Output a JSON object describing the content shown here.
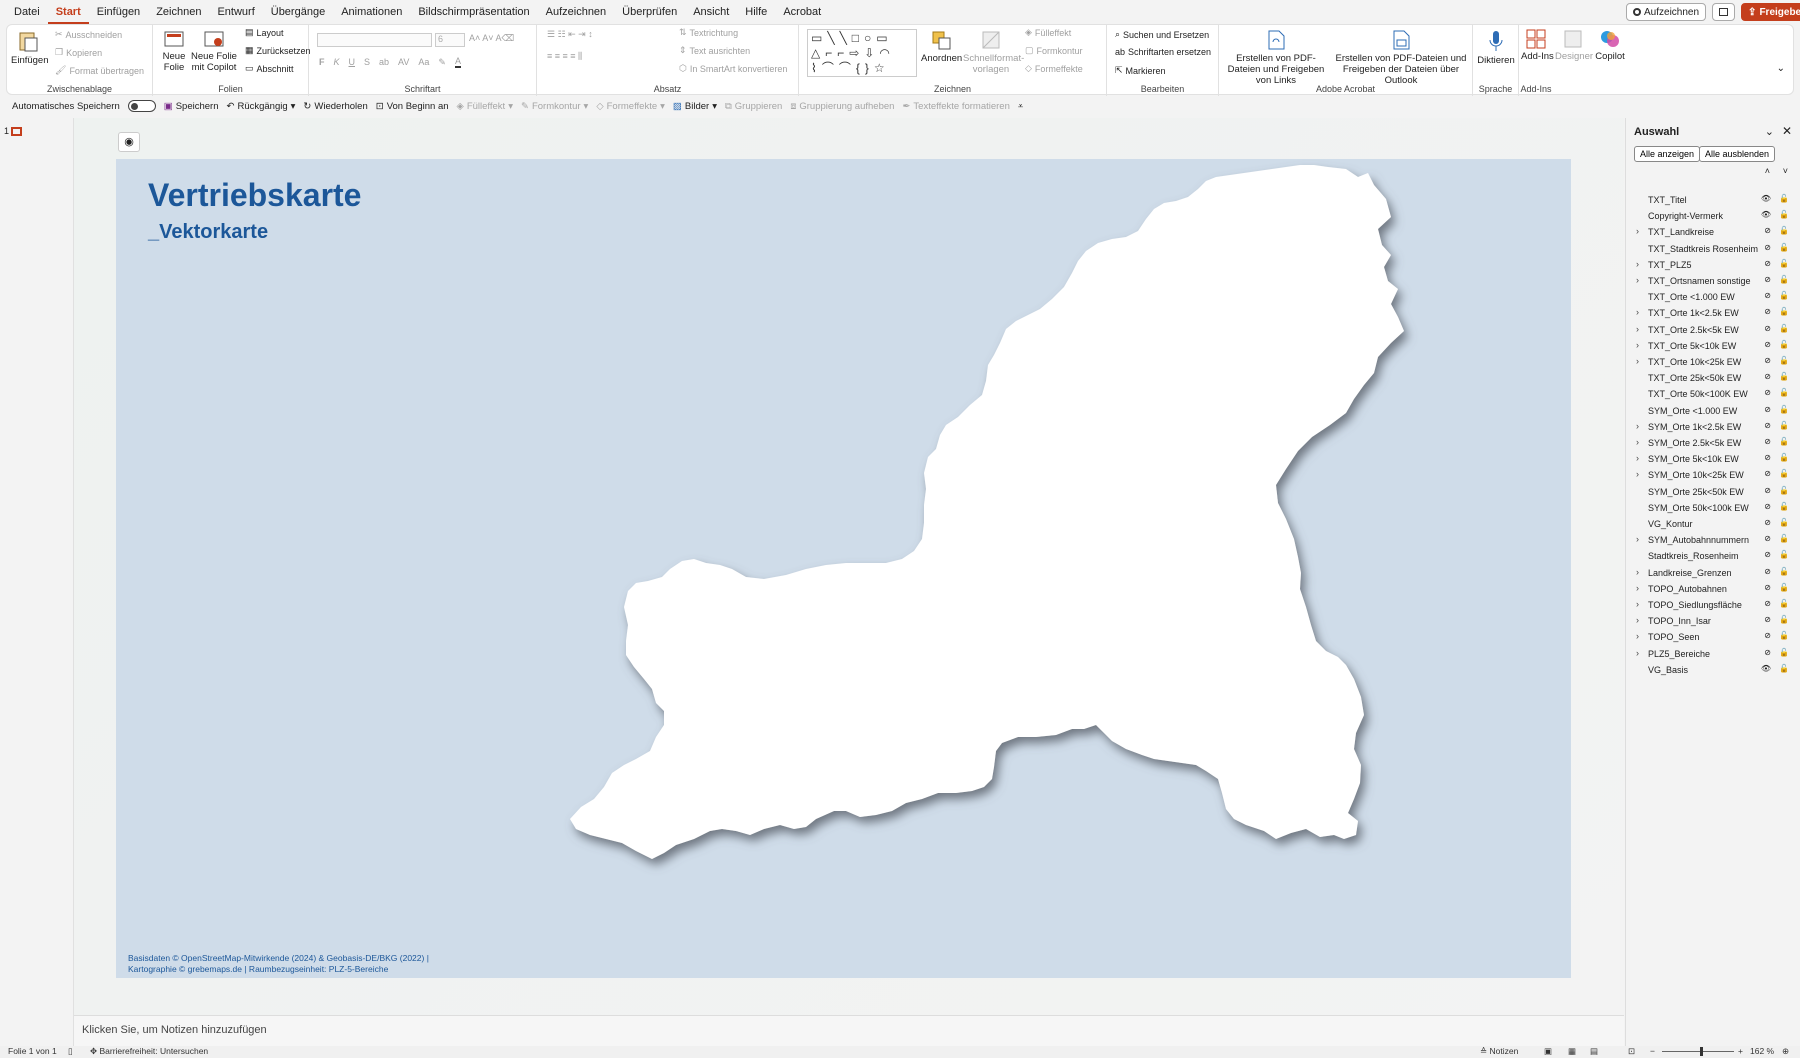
{
  "menubar": {
    "tabs": [
      "Datei",
      "Start",
      "Einfügen",
      "Zeichnen",
      "Entwurf",
      "Übergänge",
      "Animationen",
      "Bildschirmpräsentation",
      "Aufzeichnen",
      "Überprüfen",
      "Ansicht",
      "Hilfe",
      "Acrobat"
    ],
    "active_tab": "Start",
    "record_label": "Aufzeichnen",
    "share_label": "Freigeben"
  },
  "ribbon": {
    "clipboard": {
      "label": "Zwischenablage",
      "paste": "Einfügen",
      "cut": "Ausschneiden",
      "copy": "Kopieren",
      "format_painter": "Format übertragen"
    },
    "slides": {
      "label": "Folien",
      "new_slide": "Neue Folie",
      "new_slide_copilot": "Neue Folie mit Copilot",
      "layout": "Layout",
      "reset": "Zurücksetzen",
      "section": "Abschnitt"
    },
    "font": {
      "label": "Schriftart",
      "font_size": "6",
      "bold": "F",
      "italic": "K",
      "underline": "U",
      "strike": "S",
      "abc": "ab",
      "spacing": "AV",
      "case": "Aa"
    },
    "paragraph": {
      "label": "Absatz",
      "text_direction": "Textrichtung",
      "align_text": "Text ausrichten",
      "smartart": "In SmartArt konvertieren"
    },
    "drawing": {
      "label": "Zeichnen",
      "arrange": "Anordnen",
      "quick_styles": "Schnellformat-vorlagen",
      "fill": "Fülleffekt",
      "outline": "Formkontur",
      "effects": "Formeffekte"
    },
    "editing": {
      "label": "Bearbeiten",
      "find_replace": "Suchen und Ersetzen",
      "replace_fonts": "Schriftarten ersetzen",
      "select": "Markieren"
    },
    "acrobat": {
      "label": "Adobe Acrobat",
      "create_share_links": "Erstellen von PDF-Dateien und Freigeben von Links",
      "create_share_outlook": "Erstellen von PDF-Dateien und Freigeben der Dateien über Outlook"
    },
    "voice": {
      "label": "Sprache",
      "dictate": "Diktieren"
    },
    "addins": {
      "label": "Add-Ins",
      "addins": "Add-Ins",
      "designer": "Designer",
      "copilot": "Copilot"
    }
  },
  "qat": {
    "autosave": "Automatisches Speichern",
    "save": "Speichern",
    "undo": "Rückgängig",
    "redo": "Wiederholen",
    "from_start": "Von Beginn an",
    "fill": "Fülleffekt",
    "outline": "Formkontur",
    "effects": "Formeffekte",
    "pictures": "Bilder",
    "group": "Gruppieren",
    "ungroup": "Gruppierung aufheben",
    "text_effects": "Texteffekte formatieren"
  },
  "thumbnail": {
    "number": "1"
  },
  "slide": {
    "title": "Vertriebskarte",
    "subtitle": "_Vektorkarte",
    "copyright_line1": "Basisdaten © OpenStreetMap-Mitwirkende (2024)  & Geobasis-DE/BKG (2022)  |",
    "copyright_line2": "Kartographie © grebemaps.de  |  Raumbezugseinheit: PLZ-5-Bereiche",
    "colors": {
      "background": "#cfdce9",
      "title": "#1c5799",
      "region": "#ffffff"
    }
  },
  "notes": {
    "placeholder": "Klicken Sie, um Notizen hinzuzufügen"
  },
  "selection_pane": {
    "title": "Auswahl",
    "show_all": "Alle anzeigen",
    "hide_all": "Alle ausblenden",
    "items": [
      {
        "name": "TXT_Titel",
        "expandable": false,
        "visible": true
      },
      {
        "name": "Copyright-Vermerk",
        "expandable": false,
        "visible": true
      },
      {
        "name": "TXT_Landkreise",
        "expandable": true,
        "visible": false
      },
      {
        "name": "TXT_Stadtkreis Rosenheim",
        "expandable": false,
        "visible": false
      },
      {
        "name": "TXT_PLZ5",
        "expandable": true,
        "visible": false
      },
      {
        "name": "TXT_Ortsnamen sonstige",
        "expandable": true,
        "visible": false
      },
      {
        "name": "TXT_Orte <1.000 EW",
        "expandable": false,
        "visible": false
      },
      {
        "name": "TXT_Orte 1k<2.5k EW",
        "expandable": true,
        "visible": false
      },
      {
        "name": "TXT_Orte 2.5k<5k EW",
        "expandable": true,
        "visible": false
      },
      {
        "name": "TXT_Orte 5k<10k EW",
        "expandable": true,
        "visible": false
      },
      {
        "name": "TXT_Orte 10k<25k EW",
        "expandable": true,
        "visible": false
      },
      {
        "name": "TXT_Orte 25k<50k EW",
        "expandable": false,
        "visible": false
      },
      {
        "name": "TXT_Orte 50k<100K EW",
        "expandable": false,
        "visible": false
      },
      {
        "name": "SYM_Orte <1.000 EW",
        "expandable": false,
        "visible": false
      },
      {
        "name": "SYM_Orte 1k<2.5k EW",
        "expandable": true,
        "visible": false
      },
      {
        "name": "SYM_Orte 2.5k<5k EW",
        "expandable": true,
        "visible": false
      },
      {
        "name": "SYM_Orte 5k<10k EW",
        "expandable": true,
        "visible": false
      },
      {
        "name": "SYM_Orte 10k<25k EW",
        "expandable": true,
        "visible": false
      },
      {
        "name": "SYM_Orte 25k<50k EW",
        "expandable": false,
        "visible": false
      },
      {
        "name": "SYM_Orte 50k<100k EW",
        "expandable": false,
        "visible": false
      },
      {
        "name": "VG_Kontur",
        "expandable": false,
        "visible": false
      },
      {
        "name": "SYM_Autobahnnummern",
        "expandable": true,
        "visible": false
      },
      {
        "name": "Stadtkreis_Rosenheim",
        "expandable": false,
        "visible": false
      },
      {
        "name": "Landkreise_Grenzen",
        "expandable": true,
        "visible": false
      },
      {
        "name": "TOPO_Autobahnen",
        "expandable": true,
        "visible": false
      },
      {
        "name": "TOPO_Siedlungsfläche",
        "expandable": true,
        "visible": false
      },
      {
        "name": "TOPO_Inn_Isar",
        "expandable": true,
        "visible": false
      },
      {
        "name": "TOPO_Seen",
        "expandable": true,
        "visible": false
      },
      {
        "name": "PLZ5_Bereiche",
        "expandable": true,
        "visible": false
      },
      {
        "name": "VG_Basis",
        "expandable": false,
        "visible": true
      }
    ]
  },
  "statusbar": {
    "slide_info": "Folie 1 von 1",
    "accessibility": "Barrierefreiheit: Untersuchen",
    "notes": "Notizen",
    "zoom": "162 %"
  }
}
